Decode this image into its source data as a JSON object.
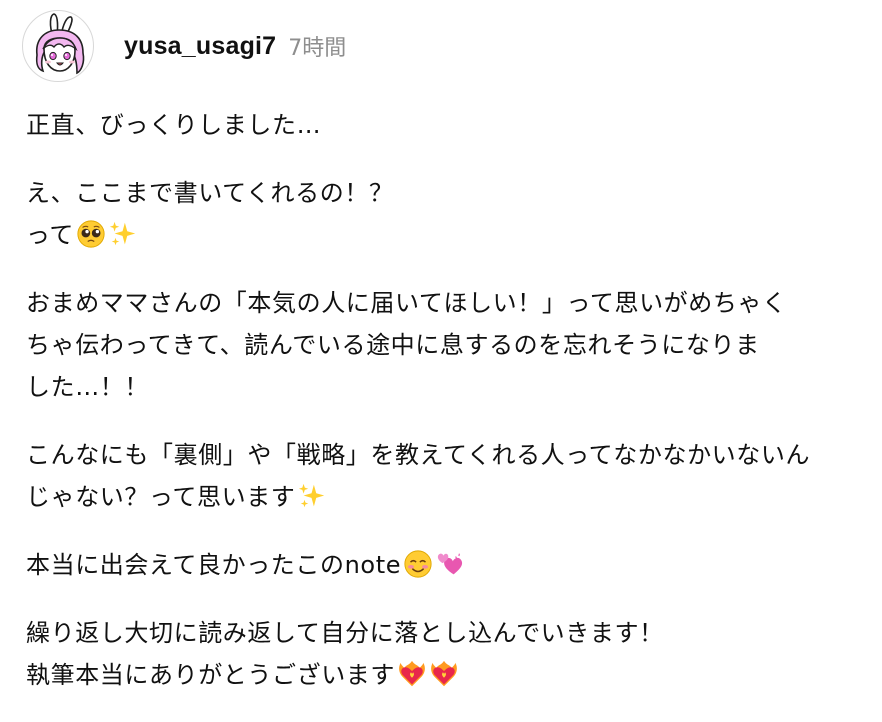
{
  "comment": {
    "username": "yusa_usagi7",
    "timestamp": "7時間",
    "avatar_icon": "bunny-girl-avatar-icon",
    "paragraphs": [
      {
        "lines": [
          {
            "text": "正直、びっくりしました…",
            "emojis": []
          }
        ]
      },
      {
        "lines": [
          {
            "text": "え、ここまで書いてくれるの！？",
            "emojis": []
          },
          {
            "text": "って",
            "emojis": [
              "pleading-face-emoji",
              "sparkles-emoji"
            ]
          }
        ]
      },
      {
        "lines": [
          {
            "text": "おまめママさんの「本気の人に届いてほしい！」って思いがめちゃく",
            "emojis": []
          },
          {
            "text": "ちゃ伝わってきて、読んでいる途中に息するのを忘れそうになりま",
            "emojis": []
          },
          {
            "text": "した…！！",
            "emojis": []
          }
        ]
      },
      {
        "lines": [
          {
            "text": "こんなにも「裏側」や「戦略」を教えてくれる人ってなかなかいないん",
            "emojis": []
          },
          {
            "text": "じゃない？って思います",
            "emojis": [
              "sparkles-emoji"
            ]
          }
        ]
      },
      {
        "lines": [
          {
            "text": "本当に出会えて良かったこのnote",
            "emojis": [
              "smiling-face-emoji",
              "two-hearts-emoji"
            ]
          }
        ]
      },
      {
        "lines": [
          {
            "text": "繰り返し大切に読み返して自分に落とし込んでいきます！",
            "emojis": []
          },
          {
            "text": "執筆本当にありがとうございます",
            "emojis": [
              "heart-on-fire-emoji",
              "heart-on-fire-emoji"
            ]
          }
        ]
      }
    ]
  }
}
